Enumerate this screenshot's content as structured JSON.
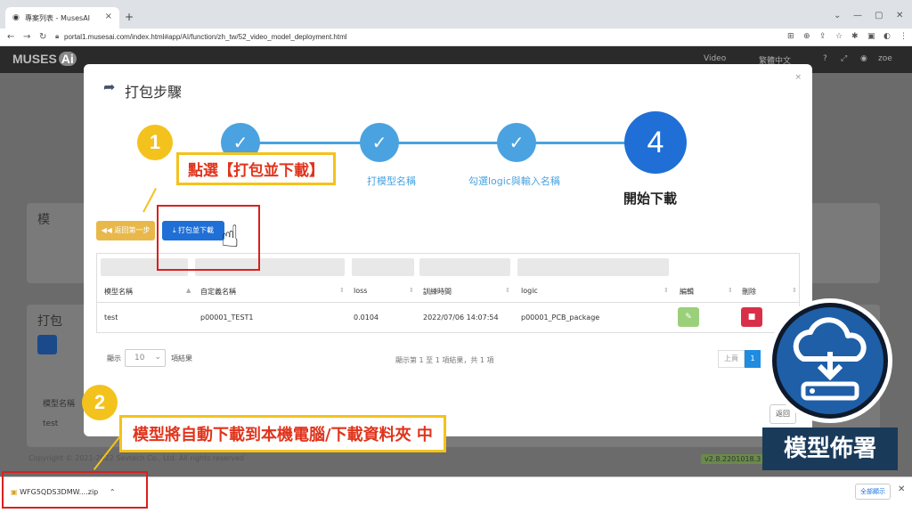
{
  "browser": {
    "tab_title": "專案列表 - MusesAI",
    "tab_close": "×",
    "new_tab": "+",
    "url": "portal1.musesai.com/index.html#app/AI/function/zh_tw/52_video_model_deployment.html",
    "win_min": "—",
    "win_max": "▢",
    "win_close": "✕",
    "profile": "zoe"
  },
  "app": {
    "logo": "MUSES",
    "logo_badge": "Ai",
    "header_video": "Video",
    "header_lang": "繁體中文",
    "bg_card1_title": "模",
    "bg_card2_title": "打包",
    "bg_col_header": "模型名稱",
    "bg_row1": "test",
    "copyright": "Copyright © 2021-2022 Sevtech Co., Ltd. All rights reserved",
    "version": "v2.8.2201018.3"
  },
  "modal": {
    "title": "打包步驟",
    "close": "×",
    "steps": [
      {
        "label": "",
        "icon": "✓"
      },
      {
        "label": "打模型名稱",
        "icon": "✓"
      },
      {
        "label": "勾選logic與輸入名稱",
        "icon": "✓"
      },
      {
        "label": "開始下載",
        "icon": "4"
      }
    ],
    "back_button": "◀◀ 返回第一步",
    "pack_button": "⤓ 打包並下載",
    "columns": [
      "模型名稱",
      "自定義名稱",
      "loss",
      "訓練時間",
      "logic",
      "編輯",
      "刪除"
    ],
    "rows": [
      {
        "model": "test",
        "custom": "p00001_TEST1",
        "loss": "0.0104",
        "time": "2022/07/06 14:07:54",
        "logic": "p00001_PCB_package"
      }
    ],
    "show_label": "顯示",
    "page_size": "10",
    "entries_label": "項結果",
    "info": "顯示第 1 至 1 項結果，共 1 項",
    "prev": "上頁",
    "page": "1",
    "return_button": "返回"
  },
  "annotations": {
    "badge1": "1",
    "callout1": "點選【打包並下載】",
    "badge2": "2",
    "callout2": "模型將自動下載到本機電腦/下載資料夾 中"
  },
  "download": {
    "filename": "WFG5QDS3DMW....zip",
    "chevron": "⌃",
    "show_all": "全部顯示",
    "close": "✕"
  },
  "deploy_badge": {
    "label": "模型佈署"
  },
  "colors": {
    "accent": "#1f6fd6",
    "step": "#4aa3e0",
    "annotation": "#f4c21c",
    "highlight": "#d92020"
  }
}
